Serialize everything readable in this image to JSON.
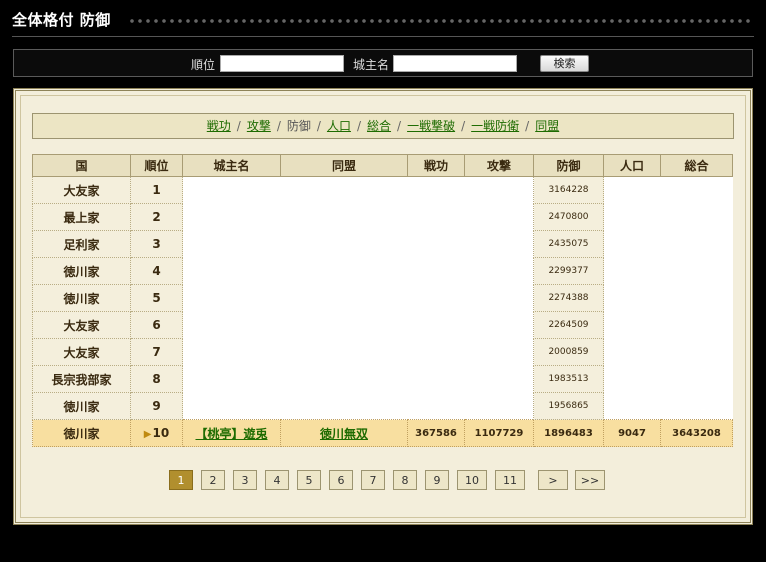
{
  "header": {
    "title": "全体格付 防御"
  },
  "search": {
    "rank_label": "順位",
    "rank_value": "",
    "lord_label": "城主名",
    "lord_value": "",
    "button_label": "検索"
  },
  "tabs": [
    {
      "label": "戦功",
      "active": false
    },
    {
      "label": "攻撃",
      "active": false
    },
    {
      "label": "防御",
      "active": true
    },
    {
      "label": "人口",
      "active": false
    },
    {
      "label": "総合",
      "active": false
    },
    {
      "label": "一戦撃破",
      "active": false
    },
    {
      "label": "一戦防衛",
      "active": false
    },
    {
      "label": "同盟",
      "active": false
    }
  ],
  "tab_separator": "/",
  "table": {
    "headers": [
      "国",
      "順位",
      "城主名",
      "同盟",
      "戦功",
      "攻撃",
      "防御",
      "人口",
      "総合"
    ],
    "rows": [
      {
        "country": "大友家",
        "rank": "1",
        "defense": "3164228"
      },
      {
        "country": "最上家",
        "rank": "2",
        "defense": "2470800"
      },
      {
        "country": "足利家",
        "rank": "3",
        "defense": "2435075"
      },
      {
        "country": "徳川家",
        "rank": "4",
        "defense": "2299377"
      },
      {
        "country": "徳川家",
        "rank": "5",
        "defense": "2274388"
      },
      {
        "country": "大友家",
        "rank": "6",
        "defense": "2264509"
      },
      {
        "country": "大友家",
        "rank": "7",
        "defense": "2000859"
      },
      {
        "country": "長宗我部家",
        "rank": "8",
        "defense": "1983513"
      },
      {
        "country": "徳川家",
        "rank": "9",
        "defense": "1956865"
      }
    ],
    "self_row": {
      "country": "徳川家",
      "rank": "10",
      "lord": "【桃亭】遊兎",
      "alliance": "徳川無双",
      "merit": "367586",
      "attack": "1107729",
      "defense": "1896483",
      "population": "9047",
      "total": "3643208"
    }
  },
  "pager": {
    "pages": [
      "1",
      "2",
      "3",
      "4",
      "5",
      "6",
      "7",
      "8",
      "9",
      "10",
      "11"
    ],
    "current": "1",
    "next_label": ">",
    "last_label": ">>"
  },
  "colors": {
    "background": "#000000",
    "panel": "#f3eedb",
    "link": "#1d6b00",
    "highlight_row": "#f8dfa0",
    "active_page": "#b18f2e"
  }
}
